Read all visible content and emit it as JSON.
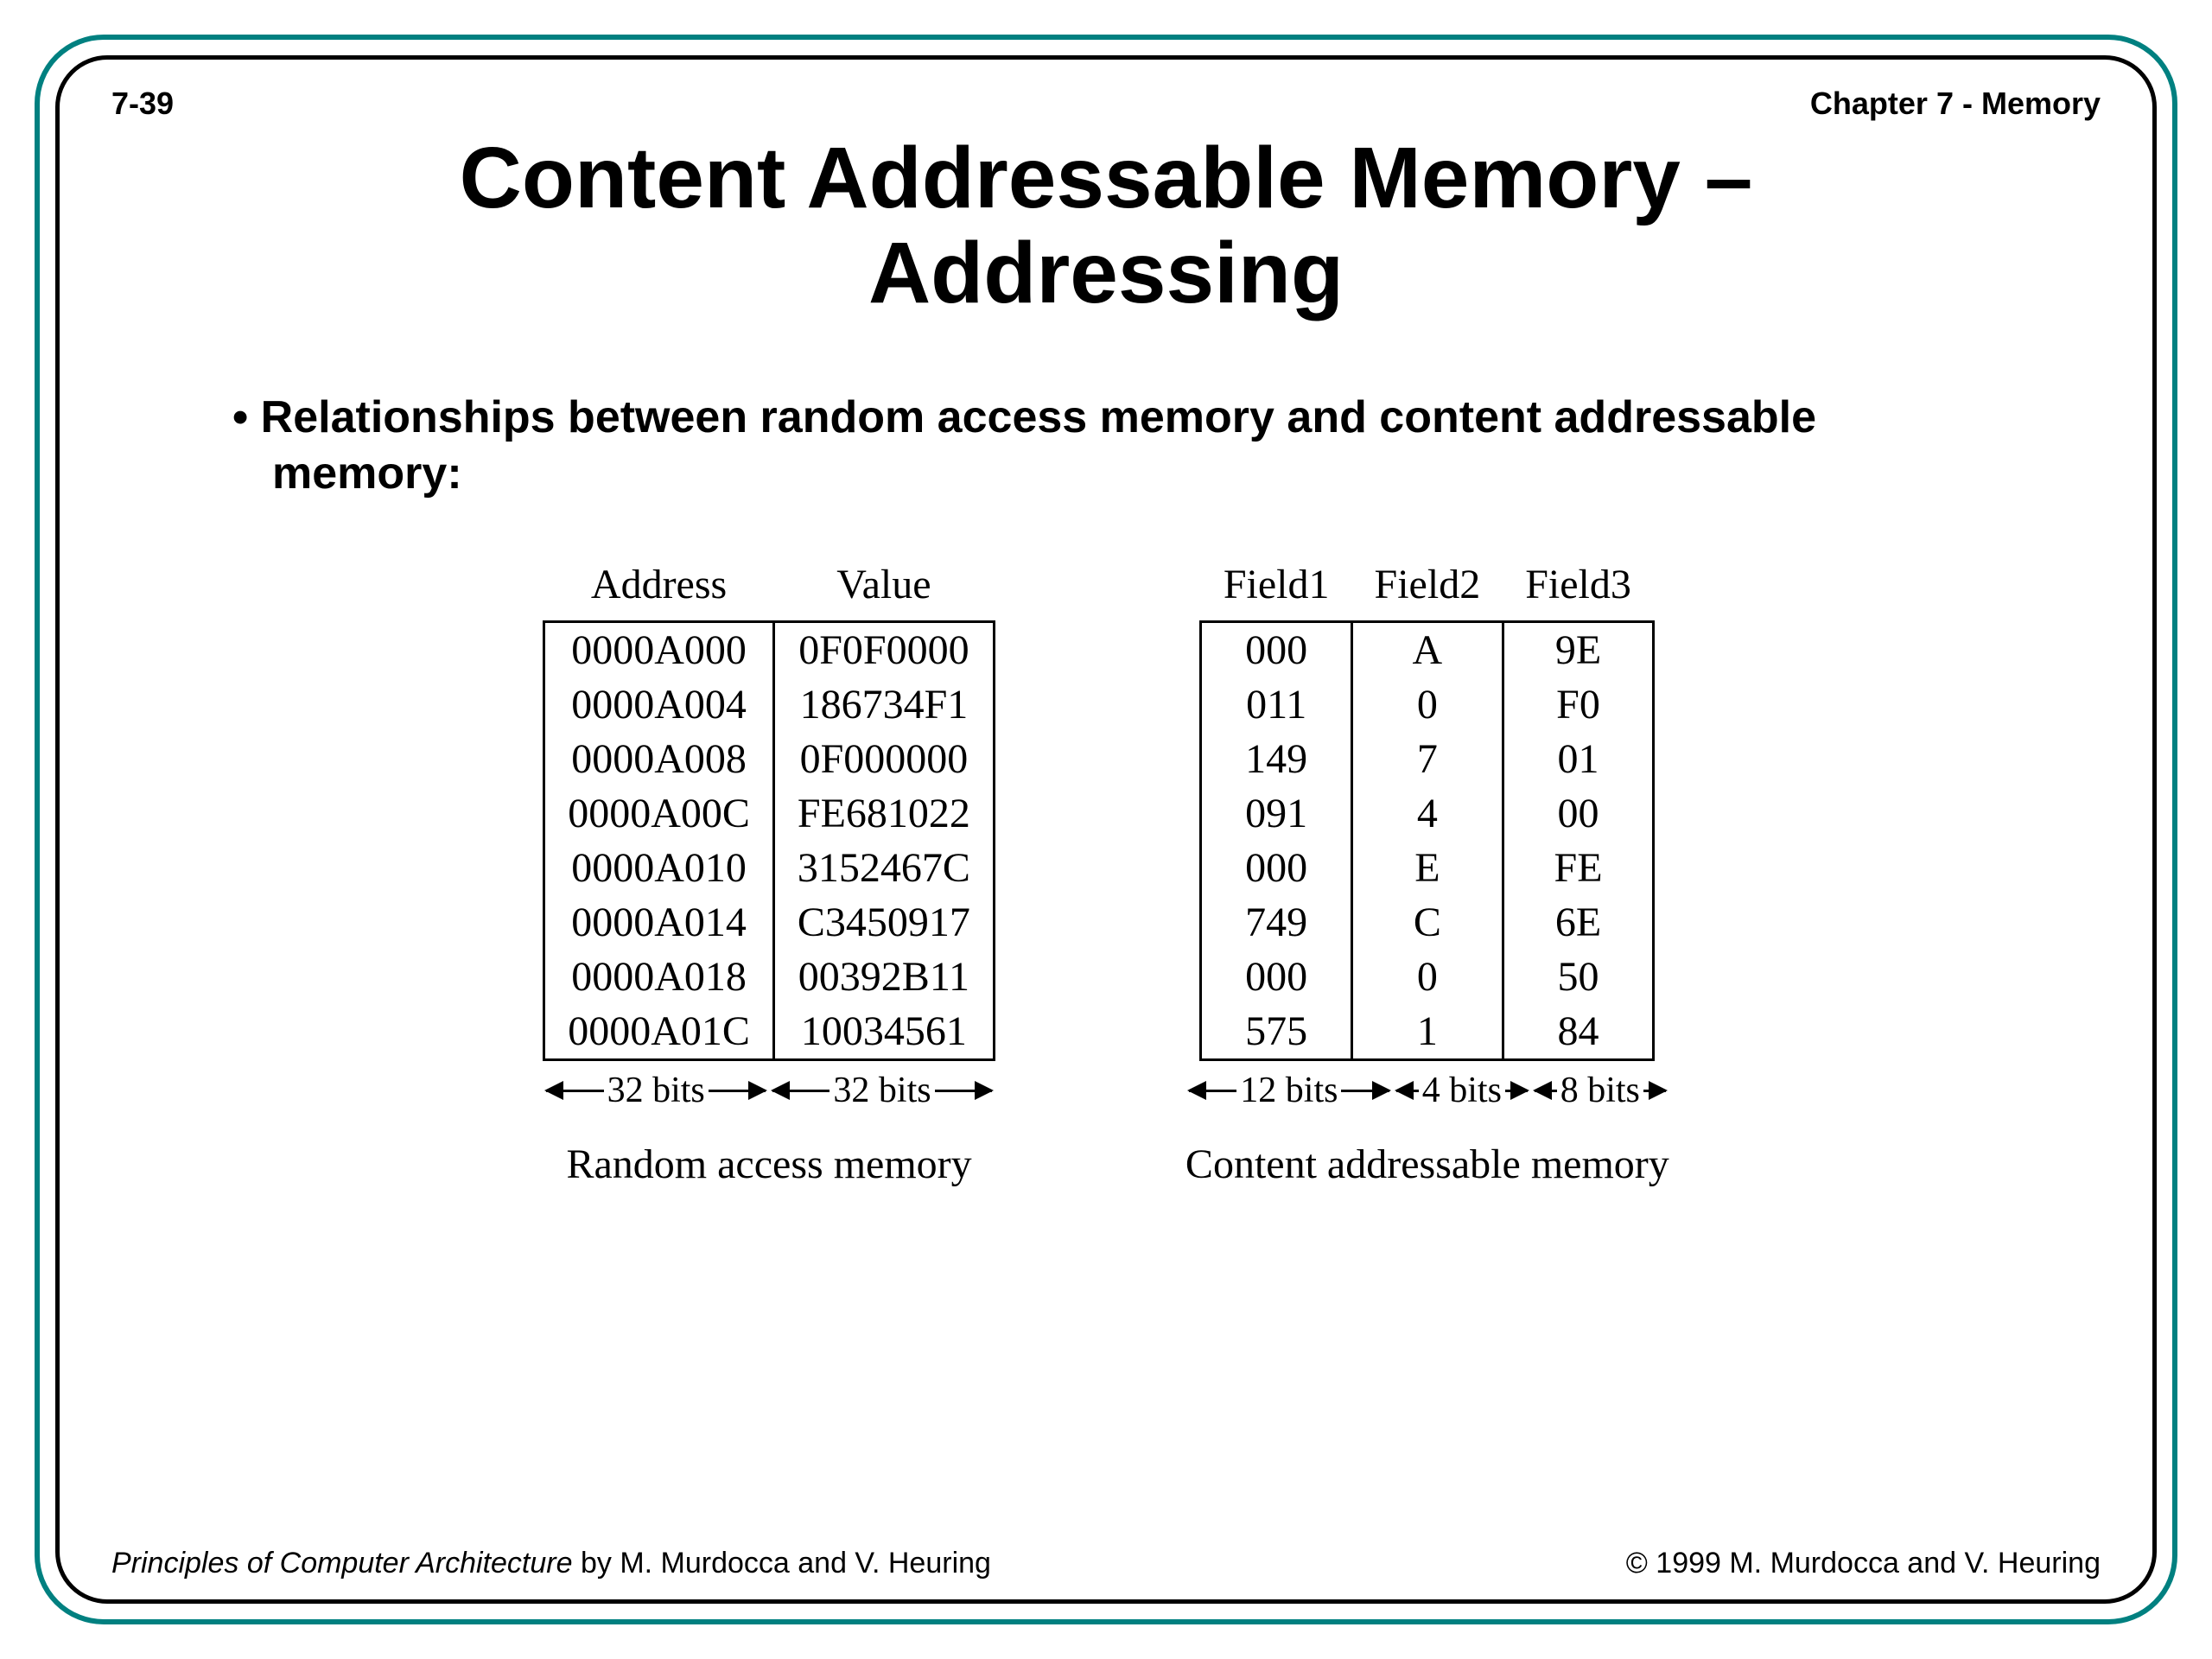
{
  "header": {
    "page_num": "7-39",
    "chapter": "Chapter 7 - Memory"
  },
  "title_line1": "Content Addressable Memory –",
  "title_line2": "Addressing",
  "bullet_text": "Relationships between random access memory and content addressable memory:",
  "ram": {
    "head_addr": "Address",
    "head_val": "Value",
    "rows": [
      {
        "a": "0000A000",
        "v": "0F0F0000"
      },
      {
        "a": "0000A004",
        "v": "186734F1"
      },
      {
        "a": "0000A008",
        "v": "0F000000"
      },
      {
        "a": "0000A00C",
        "v": "FE681022"
      },
      {
        "a": "0000A010",
        "v": "3152467C"
      },
      {
        "a": "0000A014",
        "v": "C3450917"
      },
      {
        "a": "0000A018",
        "v": "00392B11"
      },
      {
        "a": "0000A01C",
        "v": "10034561"
      }
    ],
    "bits_addr": "32 bits",
    "bits_val": "32 bits",
    "caption": "Random access memory"
  },
  "cam": {
    "head_f1": "Field1",
    "head_f2": "Field2",
    "head_f3": "Field3",
    "rows": [
      {
        "f1": "000",
        "f2": "A",
        "f3": "9E"
      },
      {
        "f1": "011",
        "f2": "0",
        "f3": "F0"
      },
      {
        "f1": "149",
        "f2": "7",
        "f3": "01"
      },
      {
        "f1": "091",
        "f2": "4",
        "f3": "00"
      },
      {
        "f1": "000",
        "f2": "E",
        "f3": "FE"
      },
      {
        "f1": "749",
        "f2": "C",
        "f3": "6E"
      },
      {
        "f1": "000",
        "f2": "0",
        "f3": "50"
      },
      {
        "f1": "575",
        "f2": "1",
        "f3": "84"
      }
    ],
    "bits_f1": "12 bits",
    "bits_f2": "4 bits",
    "bits_f3": "8 bits",
    "caption": "Content addressable memory"
  },
  "footer": {
    "book_title": "Principles of Computer Architecture",
    "authors": " by M. Murdocca and V. Heuring",
    "copyright": "© 1999 M. Murdocca and V. Heuring"
  }
}
